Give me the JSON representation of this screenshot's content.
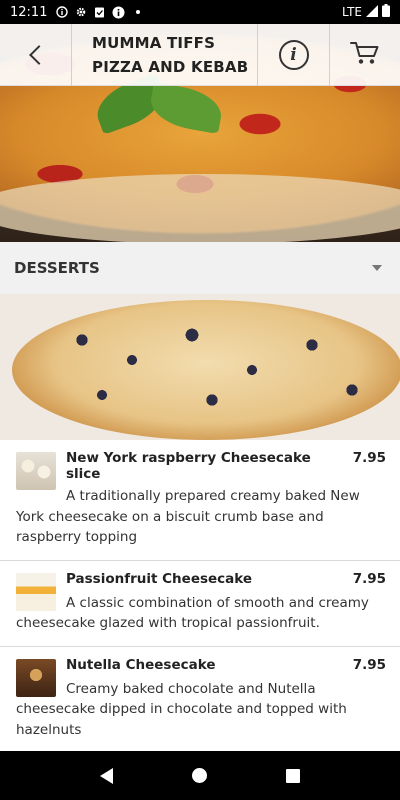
{
  "status": {
    "time": "12:11",
    "icons": [
      "info-icon",
      "gear-icon",
      "clipboard-icon",
      "info-icon",
      "dot-icon"
    ],
    "network": "LTE"
  },
  "header": {
    "title_line1": "MUMMA TIFFS",
    "title_line2": "PIZZA AND KEBAB"
  },
  "section": {
    "title": "DESSERTS"
  },
  "items": [
    {
      "name": "New York raspberry Cheesecake slice",
      "price": "7.95",
      "description": "A traditionally prepared creamy baked New York cheesecake on a biscuit crumb base and raspberry topping"
    },
    {
      "name": "Passionfruit Cheesecake",
      "price": "7.95",
      "description": "A classic combination of smooth and creamy cheesecake glazed with tropical passionfruit."
    },
    {
      "name": "Nutella Cheesecake",
      "price": "7.95",
      "description": "Creamy baked chocolate and Nutella cheesecake dipped in chocolate and topped with hazelnuts"
    }
  ]
}
